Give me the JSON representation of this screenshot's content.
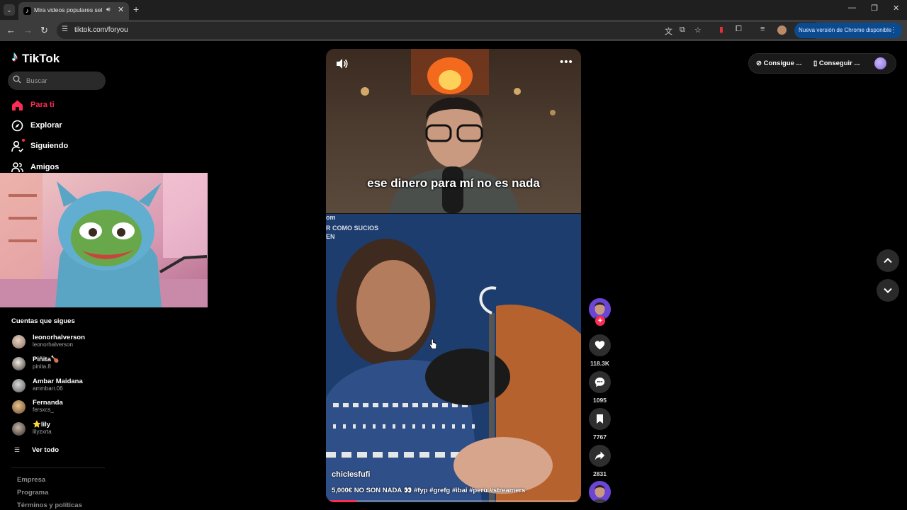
{
  "browser": {
    "tab_title": "Mira videos populares seleccionados para ti | TikTok",
    "url": "tiktok.com/foryou",
    "update_label": "Nueva versión de Chrome disponible"
  },
  "sidebar": {
    "logo_text": "TikTok",
    "search_placeholder": "Buscar",
    "nav": [
      {
        "label": "Para ti"
      },
      {
        "label": "Explorar"
      },
      {
        "label": "Siguiendo"
      },
      {
        "label": "Amigos"
      }
    ],
    "following_title": "Cuentas que sigues",
    "accounts": [
      {
        "name": "leonorhalverson",
        "username": "leonorhalverson"
      },
      {
        "name": "Piñita🍗",
        "username": "pinita.8"
      },
      {
        "name": "Ambar Maidana",
        "username": "ammbarr.06"
      },
      {
        "name": "Fernanda",
        "username": "fersxcs_"
      },
      {
        "name": "⭐lily",
        "username": "lilyzxrta"
      }
    ],
    "see_all": "Ver todo",
    "footer": [
      "Empresa",
      "Programa",
      "Términos y políticas"
    ]
  },
  "video": {
    "subtitle": "ese dinero para mí no es nada",
    "overlay_line1": "om",
    "overlay_line2": "R COMO SUCIOS",
    "overlay_line3": "EN",
    "author": "chiclesfufi",
    "caption": "5,000€ NO SON NADA 👀 #fyp #grefg #ibai #perú #streamers",
    "progress": 0.12
  },
  "actions": {
    "likes": "118.3K",
    "comments": "1095",
    "saves": "7767",
    "shares": "2831"
  },
  "topright": {
    "coins": "Consigue ...",
    "app": "Conseguir ..."
  },
  "colors": {
    "accent": "#fe2c55",
    "chrome_bg": "#3c3c3c",
    "update_pill": "#0b4a8f"
  }
}
